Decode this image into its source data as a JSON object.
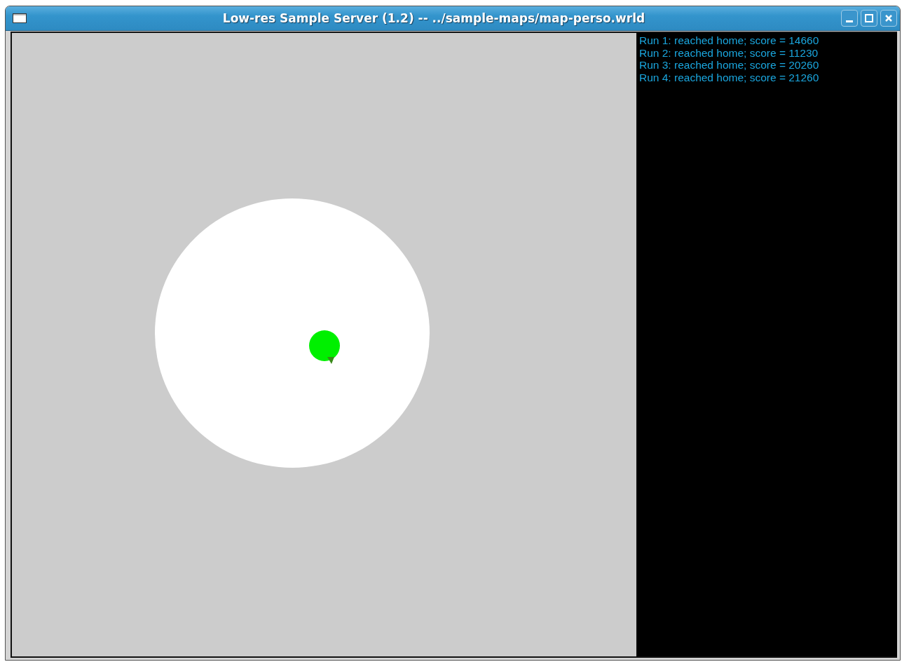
{
  "window": {
    "title": "Low-res Sample Server (1.2) -- ../sample-maps/map-perso.wrld"
  },
  "log": [
    "Run 1: reached home; score = 14660",
    "Run 2: reached home; score = 11230",
    "Run 3: reached home; score = 20260",
    "Run 4: reached home; score = 21260"
  ]
}
